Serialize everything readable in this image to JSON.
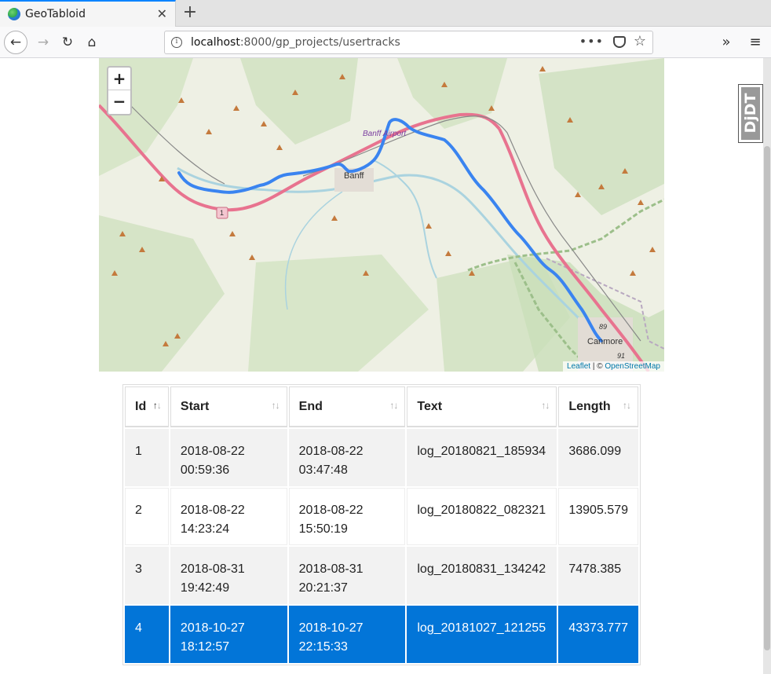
{
  "browser": {
    "tab_title": "GeoTabloid",
    "url_host": "localhost",
    "url_rest": ":8000/gp_projects/usertracks",
    "dots": "•••"
  },
  "debug_toolbar": {
    "label": "DjDT"
  },
  "map": {
    "zoom_in": "+",
    "zoom_out": "−",
    "labels": {
      "banff": "Banff",
      "airport": "Banff Airport",
      "canmore": "Canmore",
      "highway_1": "1",
      "r89": "89",
      "r91": "91"
    },
    "attribution": {
      "leaflet": "Leaflet",
      "sep": " | © ",
      "osm": "OpenStreetMap"
    },
    "colors": {
      "track": "#3a84f0",
      "highway": "#e8738f",
      "forest": "#d4e4c8",
      "water": "#aad3df"
    }
  },
  "table": {
    "headers": [
      "Id",
      "Start",
      "End",
      "Text",
      "Length"
    ],
    "rows": [
      {
        "id": "1",
        "start_date": "2018-08-22",
        "start_time": "00:59:36",
        "end_date": "2018-08-22",
        "end_time": "03:47:48",
        "text": "log_20180821_185934",
        "length": "3686.099"
      },
      {
        "id": "2",
        "start_date": "2018-08-22",
        "start_time": "14:23:24",
        "end_date": "2018-08-22",
        "end_time": "15:50:19",
        "text": "log_20180822_082321",
        "length": "13905.579"
      },
      {
        "id": "3",
        "start_date": "2018-08-31",
        "start_time": "19:42:49",
        "end_date": "2018-08-31",
        "end_time": "20:21:37",
        "text": "log_20180831_134242",
        "length": "7478.385"
      },
      {
        "id": "4",
        "start_date": "2018-10-27",
        "start_time": "18:12:57",
        "end_date": "2018-10-27",
        "end_time": "22:15:33",
        "text": "log_20181027_121255",
        "length": "43373.777"
      }
    ],
    "selected_row": 3
  }
}
